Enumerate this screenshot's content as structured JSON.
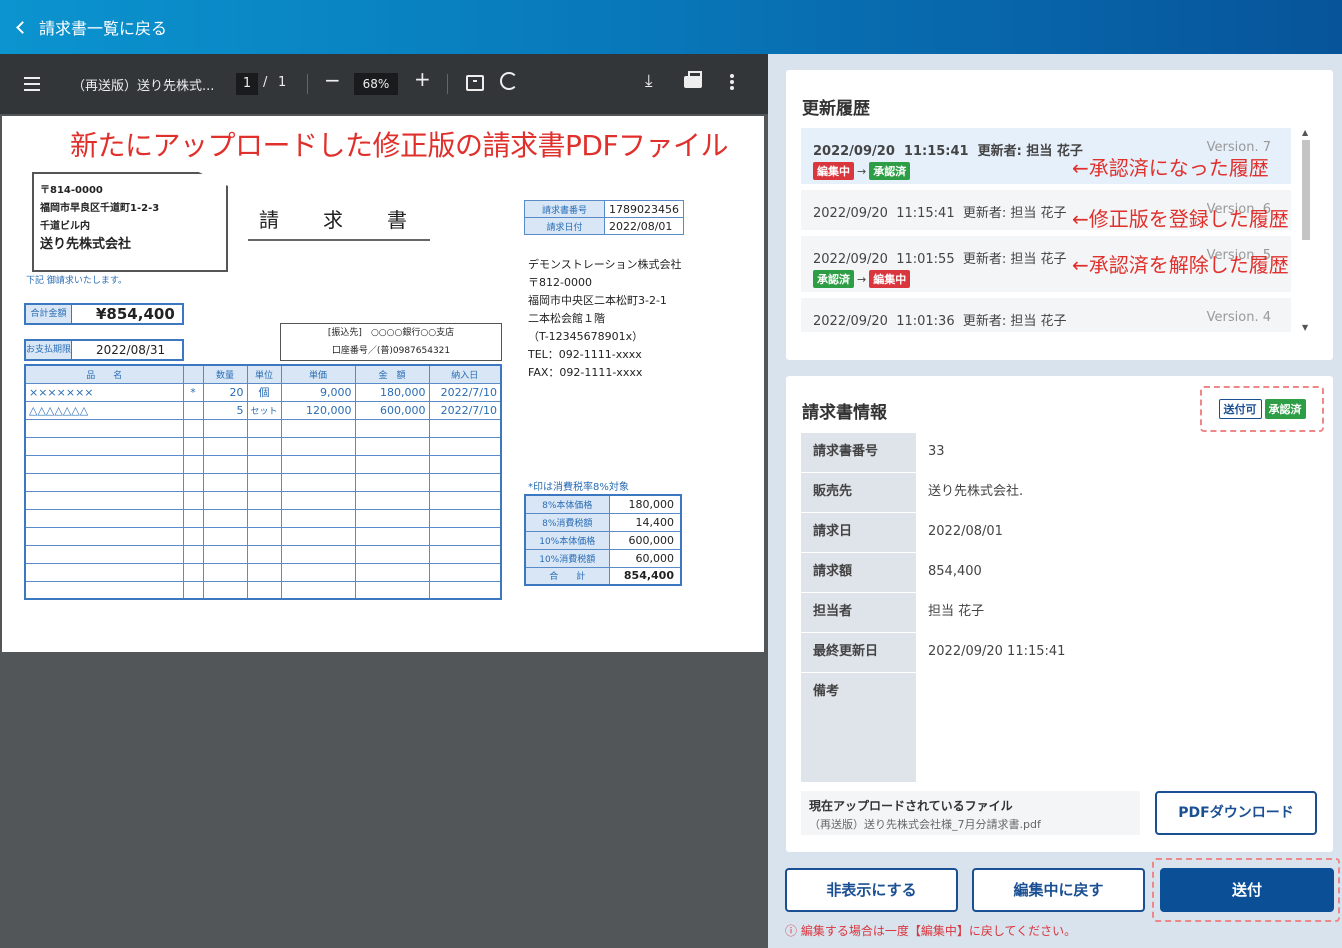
{
  "header": {
    "back_label": "請求書一覧に戻る"
  },
  "viewer": {
    "doc_title": "（再送版）送り先株式...",
    "page_current": "1",
    "page_sep": "/",
    "page_total": "1",
    "zoom_minus": "−",
    "zoom": "68%",
    "zoom_plus": "+"
  },
  "document": {
    "red_note": "新たにアップロードした修正版の請求書PDFファイル",
    "address": {
      "postal": "〒814-0000",
      "line1": "福岡市早良区千道町1-2-3",
      "line2": "千道ビル内",
      "company": "送り先株式会社"
    },
    "intro": "下記 御請求いたします。",
    "title": "請　求　書",
    "meta": [
      {
        "k": "請求書番号",
        "v": "1789023456"
      },
      {
        "k": "請求日付",
        "v": "2022/08/01"
      }
    ],
    "sender": [
      "デモンストレーション株式会社",
      "〒812-0000",
      "福岡市中央区二本松町3-2-1",
      "二本松会館１階",
      "（T-12345678901x）",
      "TEL：092-1111-xxxx",
      "FAX：092-1111-xxxx"
    ],
    "total_label": "合計金額",
    "total_value": "¥854,400",
    "due_label": "お支払期限",
    "due_value": "2022/08/31",
    "bank_line1": "[振込先]　○○○○銀行○○支店",
    "bank_line2": "口座番号／(普)0987654321",
    "item_headers": [
      "品　　名",
      "",
      "数量",
      "単位",
      "単価",
      "金　額",
      "納入日"
    ],
    "items": [
      [
        "×××××××",
        "*",
        "20",
        "個",
        "9,000",
        "180,000",
        "2022/7/10"
      ],
      [
        "△△△△△△△",
        "",
        "5",
        "セット",
        "120,000",
        "600,000",
        "2022/7/10"
      ]
    ],
    "tax_note": "*印は消費税率8%対象",
    "summary": [
      {
        "k": "8%本体価格",
        "v": "180,000"
      },
      {
        "k": "8%消費税額",
        "v": "14,400"
      },
      {
        "k": "10%本体価格",
        "v": "600,000"
      },
      {
        "k": "10%消費税額",
        "v": "60,000"
      },
      {
        "k": "合　　計",
        "v": "854,400"
      }
    ]
  },
  "history": {
    "title": "更新履歴",
    "entries": [
      {
        "date": "2022/09/20",
        "time": "11:15:41",
        "user": "更新者: 担当 花子",
        "version": "Version. 7",
        "from": "編集中",
        "to": "承認済"
      },
      {
        "date": "2022/09/20",
        "time": "11:15:41",
        "user": "更新者: 担当 花子",
        "version": "Version. 6"
      },
      {
        "date": "2022/09/20",
        "time": "11:01:55",
        "user": "更新者: 担当 花子",
        "version": "Version. 5",
        "from": "承認済",
        "to": "編集中"
      },
      {
        "date": "2022/09/20",
        "time": "11:01:36",
        "user": "更新者: 担当 花子",
        "version": "Version. 4"
      }
    ],
    "arrow": "→",
    "annotations": [
      "←承認済になった履歴",
      "←修正版を登録した履歴",
      "←承認済を解除した履歴"
    ]
  },
  "info": {
    "title": "請求書情報",
    "badge_send": "送付可",
    "badge_status": "承認済",
    "rows": [
      {
        "k": "請求書番号",
        "v": "33"
      },
      {
        "k": "販売先",
        "v": "送り先株式会社."
      },
      {
        "k": "請求日",
        "v": "2022/08/01"
      },
      {
        "k": "請求額",
        "v": "854,400"
      },
      {
        "k": "担当者",
        "v": "担当 花子"
      },
      {
        "k": "最終更新日",
        "v": "2022/09/20 11:15:41"
      },
      {
        "k": "備考",
        "v": ""
      }
    ],
    "file_label": "現在アップロードされているファイル",
    "file_name": "（再送版）送り先株式会社様_7月分請求書.pdf",
    "pdf_button": "PDFダウンロード"
  },
  "actions": {
    "hide": "非表示にする",
    "revert": "編集中に戻す",
    "send": "送付",
    "warning": "ⓘ 編集する場合は一度【編集中】に戻してください。"
  }
}
